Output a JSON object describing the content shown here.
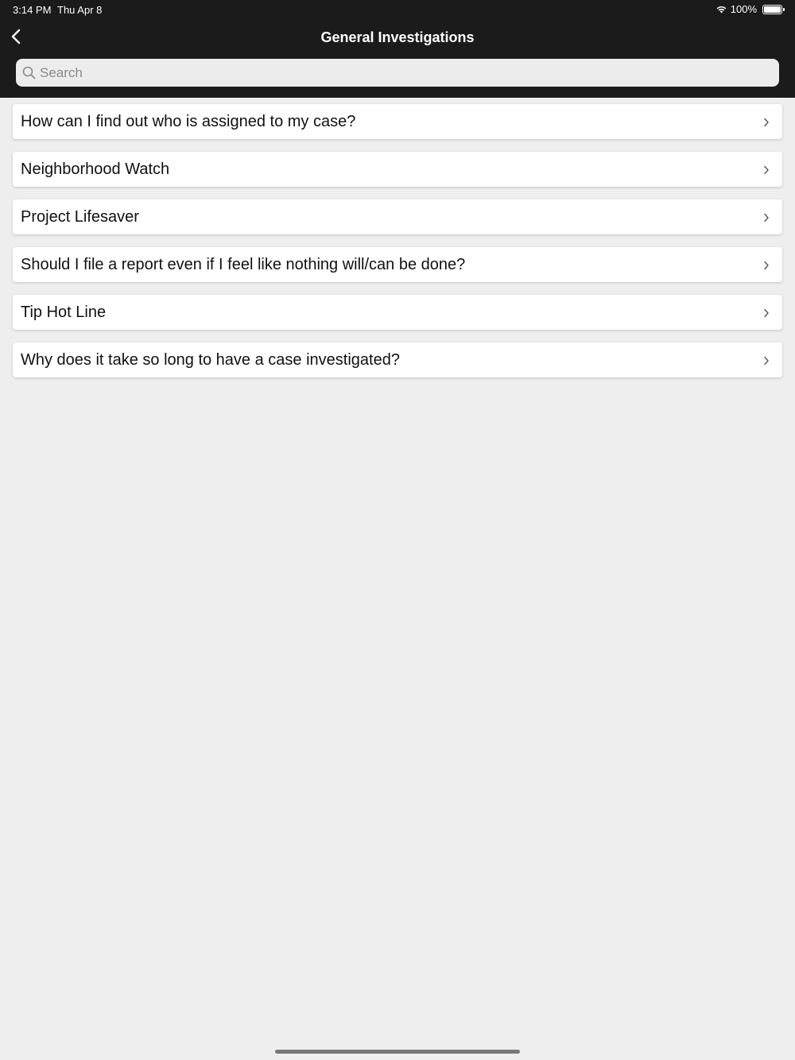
{
  "status_bar": {
    "time": "3:14 PM",
    "date": "Thu Apr 8",
    "battery": "100%"
  },
  "nav": {
    "title": "General Investigations"
  },
  "search": {
    "placeholder": "Search"
  },
  "items": [
    {
      "label": "How can I find out who is assigned to my case?"
    },
    {
      "label": "Neighborhood Watch"
    },
    {
      "label": "Project Lifesaver"
    },
    {
      "label": "Should I file a report even if I feel like nothing will/can be done?"
    },
    {
      "label": "Tip Hot Line"
    },
    {
      "label": "Why does it take so long to have a case investigated?"
    }
  ],
  "colors": {
    "header_bg": "#1b1b1b",
    "page_bg": "#eeeeee",
    "card_bg": "#ffffff"
  }
}
